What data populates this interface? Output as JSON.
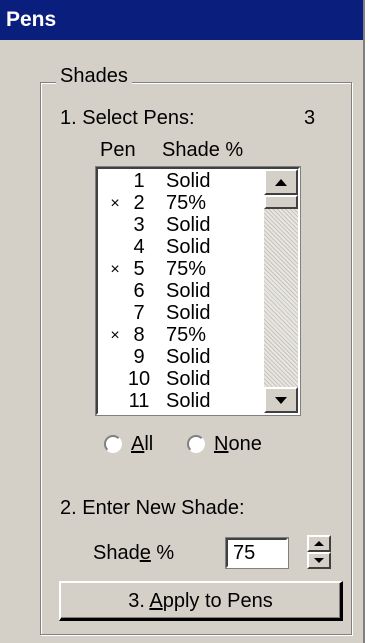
{
  "window": {
    "title": "Pens"
  },
  "group": {
    "legend": "Shades"
  },
  "select": {
    "label": "1. Select Pens:",
    "count": "3"
  },
  "columns": {
    "pen": "Pen",
    "shade": "Shade %"
  },
  "pens": [
    {
      "mark": "",
      "pen": "1",
      "shade": "Solid"
    },
    {
      "mark": "×",
      "pen": "2",
      "shade": "75%"
    },
    {
      "mark": "",
      "pen": "3",
      "shade": "Solid"
    },
    {
      "mark": "",
      "pen": "4",
      "shade": "Solid"
    },
    {
      "mark": "×",
      "pen": "5",
      "shade": "75%"
    },
    {
      "mark": "",
      "pen": "6",
      "shade": "Solid"
    },
    {
      "mark": "",
      "pen": "7",
      "shade": "Solid"
    },
    {
      "mark": "×",
      "pen": "8",
      "shade": "75%"
    },
    {
      "mark": "",
      "pen": "9",
      "shade": "Solid"
    },
    {
      "mark": "",
      "pen": "10",
      "shade": "Solid"
    },
    {
      "mark": "",
      "pen": "11",
      "shade": "Solid"
    }
  ],
  "radios": {
    "all": {
      "pre": "",
      "accel": "A",
      "post": "ll"
    },
    "none": {
      "pre": "",
      "accel": "N",
      "post": "one"
    }
  },
  "enter": {
    "label": "2. Enter New Shade:"
  },
  "shade_field": {
    "pre": "Shad",
    "accel": "e",
    "post": " %",
    "value": "75"
  },
  "apply": {
    "pre": "3. ",
    "accel": "A",
    "post": "pply to Pens"
  }
}
